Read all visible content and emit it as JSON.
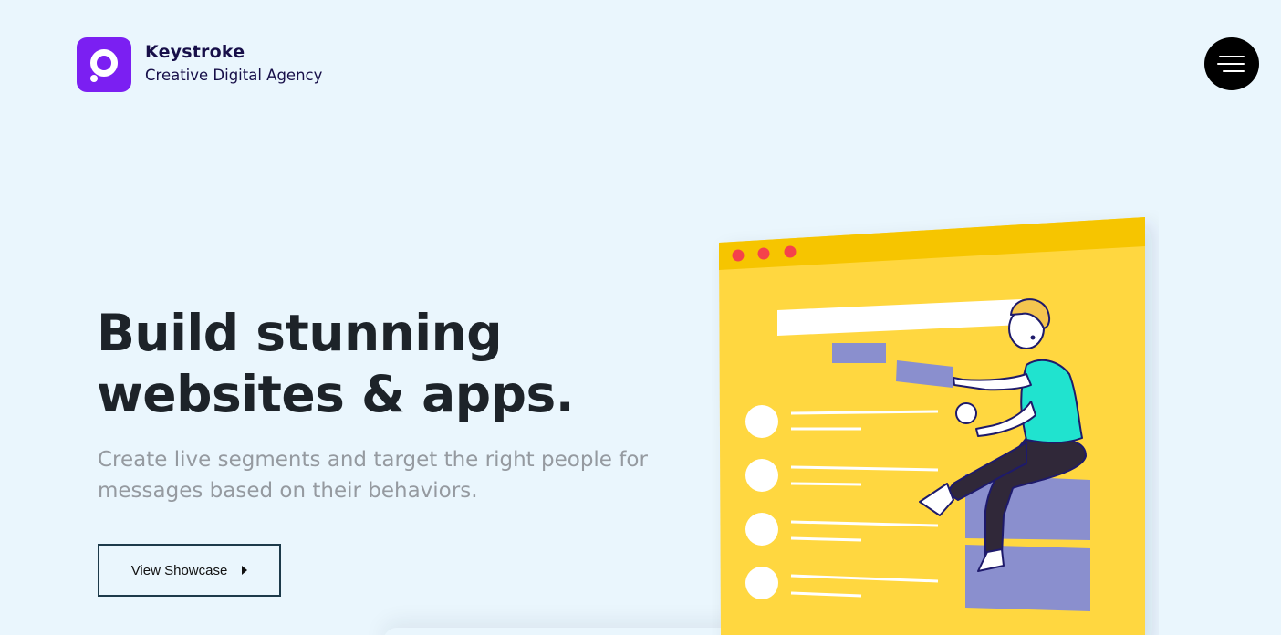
{
  "header": {
    "brand_name": "Keystroke",
    "brand_tagline": "Creative Digital Agency",
    "logo_icon": "keystroke-logo-icon",
    "menu_icon": "hamburger-menu-icon"
  },
  "hero": {
    "headline": "Build stunning websites & apps.",
    "subtext": "Create live segments and target the right people for messages based on their behaviors.",
    "cta_label": "View Showcase",
    "cta_icon": "caret-right-icon"
  },
  "colors": {
    "background": "#eaf6fd",
    "brand_purple": "#7b1ff2",
    "illustration_yellow": "#ffd73f",
    "illustration_header": "#f6c500",
    "text_dark": "#1d2329",
    "text_muted": "#959aa0"
  }
}
